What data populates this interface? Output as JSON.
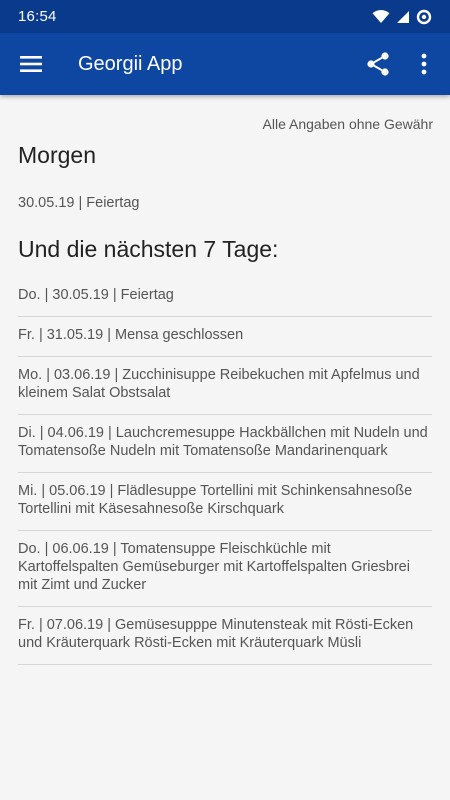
{
  "status_bar": {
    "time": "16:54",
    "icons": [
      "wifi-icon",
      "signal-icon",
      "data-saver-icon"
    ]
  },
  "app_bar": {
    "title": "Georgii App",
    "icons": [
      "menu-icon",
      "share-icon",
      "more-vert-icon"
    ],
    "color": "#0d47a1"
  },
  "content": {
    "disclaimer": "Alle Angaben ohne Gewähr",
    "today_heading": "Morgen",
    "today_item": "30.05.19 | Feiertag",
    "next_heading": "Und die nächsten 7 Tage:",
    "week_items": [
      "Do. | 30.05.19 | Feiertag",
      "Fr. | 31.05.19 | Mensa geschlossen",
      "Mo. | 03.06.19 | Zucchinisuppe Reibekuchen mit Apfelmus und kleinem Salat Obstsalat",
      "Di. | 04.06.19 | Lauchcremesuppe Hackbällchen mit Nudeln und Tomatensoße Nudeln mit Tomatensoße Mandarinenquark",
      "Mi. | 05.06.19 | Flädlesuppe Tortellini mit Schinkensahnesoße Tortellini mit Käsesahnesoße Kirschquark",
      "Do. | 06.06.19 | Tomatensuppe Fleischküchle mit Kartoffelspalten Gemüseburger mit Kartoffelspalten Griesbrei mit Zimt und Zucker",
      "Fr. | 07.06.19 | Gemüsesupppe Minutensteak mit Rösti-Ecken und Kräuterquark Rösti-Ecken mit Kräuterquark Müsli"
    ]
  }
}
